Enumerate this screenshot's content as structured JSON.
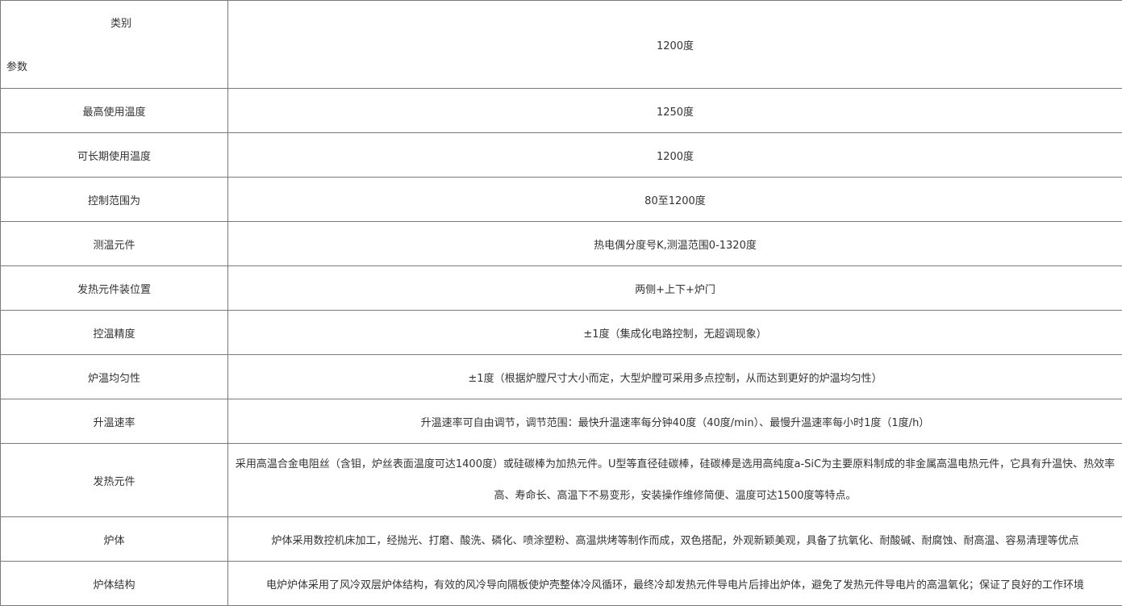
{
  "table": {
    "header": {
      "category_label": "类别",
      "param_label": "参数",
      "value": "1200度"
    },
    "rows": [
      {
        "label": "最高使用温度",
        "value": "1250度"
      },
      {
        "label": "可长期使用温度",
        "value": "1200度"
      },
      {
        "label": "控制范围为",
        "value": "80至1200度"
      },
      {
        "label": "测温元件",
        "value": "热电偶分度号K,测温范围0-1320度"
      },
      {
        "label": "发热元件装位置",
        "value": "两侧+上下+炉门"
      },
      {
        "label": "控温精度",
        "value": "±1度（集成化电路控制，无超调现象）"
      },
      {
        "label": "炉温均匀性",
        "value": "±1度（根据炉膛尺寸大小而定，大型炉膛可采用多点控制，从而达到更好的炉温均匀性）"
      },
      {
        "label": "升温速率",
        "value": "升温速率可自由调节，调节范围：最快升温速率每分钟40度（40度/min）、最慢升温速率每小时1度（1度/h）"
      },
      {
        "label": "发热元件",
        "value": "采用高温合金电阻丝（含钼，炉丝表面温度可达1400度）或硅碳棒为加热元件。U型等直径硅碳棒，硅碳棒是选用高纯度a-SiC为主要原料制成的非金属高温电热元件，它具有升温快、热效率高、寿命长、高温下不易变形，安装操作维修简便、温度可达1500度等特点。"
      },
      {
        "label": "炉体",
        "value": "炉体采用数控机床加工，经抛光、打磨、酸洗、磷化、喷涂塑粉、高温烘烤等制作而成，双色搭配，外观新颖美观，具备了抗氧化、耐酸碱、耐腐蚀、耐高温、容易清理等优点"
      },
      {
        "label": "炉体结构",
        "value": "电炉炉体采用了风冷双层炉体结构，有效的风冷导向隔板使炉壳整体冷风循环，最终冷却发热元件导电片后排出炉体，避免了发热元件导电片的高温氧化；保证了良好的工作环境"
      }
    ]
  }
}
